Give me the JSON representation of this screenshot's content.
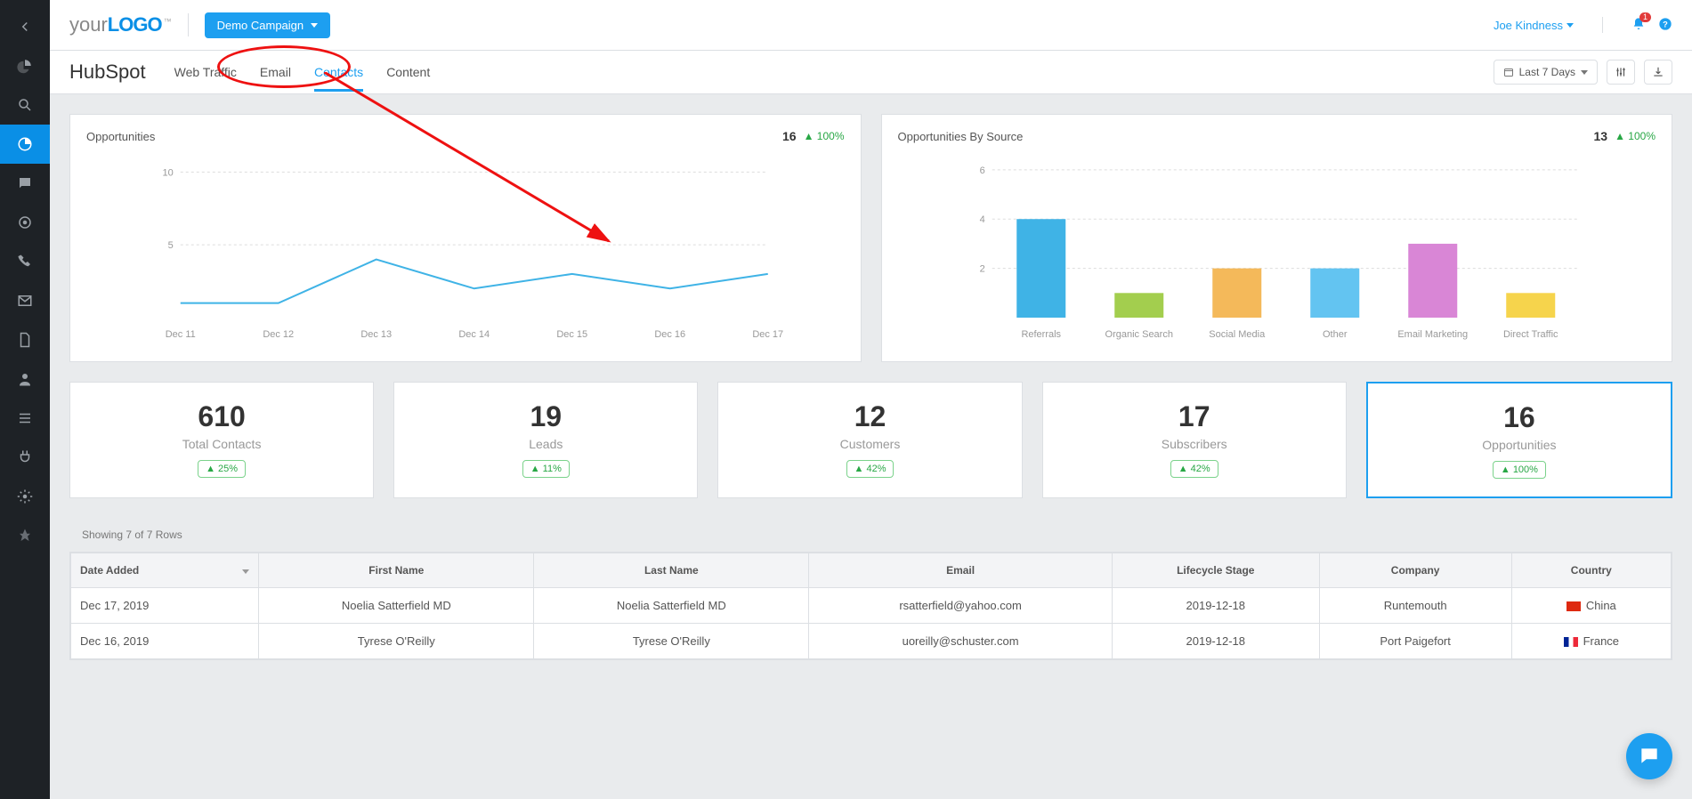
{
  "header": {
    "logo_prefix": "your",
    "logo_bold": "LOGO",
    "campaign_label": "Demo Campaign",
    "user_name": "Joe Kindness",
    "notification_count": "1"
  },
  "subnav": {
    "brand": "HubSpot",
    "tabs": [
      {
        "label": "Web Traffic",
        "active": false
      },
      {
        "label": "Email",
        "active": false
      },
      {
        "label": "Contacts",
        "active": true
      },
      {
        "label": "Content",
        "active": false
      }
    ],
    "date_range": "Last 7 Days"
  },
  "chart_data": [
    {
      "id": "opportunities",
      "type": "line",
      "title": "Opportunities",
      "metric_value": "16",
      "metric_delta": "100%",
      "categories": [
        "Dec 11",
        "Dec 12",
        "Dec 13",
        "Dec 14",
        "Dec 15",
        "Dec 16",
        "Dec 17"
      ],
      "values": [
        1,
        1,
        4,
        2,
        3,
        2,
        3
      ],
      "y_ticks": [
        5,
        10
      ],
      "ylim": [
        0,
        11
      ]
    },
    {
      "id": "opps_by_source",
      "type": "bar",
      "title": "Opportunities By Source",
      "metric_value": "13",
      "metric_delta": "100%",
      "categories": [
        "Referrals",
        "Organic Search",
        "Social Media",
        "Other",
        "Email Marketing",
        "Direct Traffic"
      ],
      "values": [
        4,
        1,
        2,
        2,
        3,
        1
      ],
      "colors": [
        "#3fb3e6",
        "#a3ce4e",
        "#f4b95a",
        "#63c4f1",
        "#d986d6",
        "#f6d44c"
      ],
      "y_ticks": [
        2,
        4,
        6
      ],
      "ylim": [
        0,
        6.5
      ]
    }
  ],
  "kpis": [
    {
      "value": "610",
      "label": "Total Contacts",
      "delta": "25%",
      "selected": false
    },
    {
      "value": "19",
      "label": "Leads",
      "delta": "11%",
      "selected": false
    },
    {
      "value": "12",
      "label": "Customers",
      "delta": "42%",
      "selected": false
    },
    {
      "value": "17",
      "label": "Subscribers",
      "delta": "42%",
      "selected": false
    },
    {
      "value": "16",
      "label": "Opportunities",
      "delta": "100%",
      "selected": true
    }
  ],
  "table": {
    "caption": "Showing 7 of 7 Rows",
    "columns": [
      "Date Added",
      "First Name",
      "Last Name",
      "Email",
      "Lifecycle Stage",
      "Company",
      "Country"
    ],
    "rows": [
      {
        "date": "Dec 17, 2019",
        "first": "Noelia Satterfield MD",
        "last": "Noelia Satterfield MD",
        "email": "rsatterfield@yahoo.com",
        "stage": "2019-12-18",
        "company": "Runtemouth",
        "country": "China",
        "flag": "cn"
      },
      {
        "date": "Dec 16, 2019",
        "first": "Tyrese O'Reilly",
        "last": "Tyrese O'Reilly",
        "email": "uoreilly@schuster.com",
        "stage": "2019-12-18",
        "company": "Port Paigefort",
        "country": "France",
        "flag": "fr"
      }
    ]
  },
  "rail_icons": [
    "chevron-left",
    "dashboard",
    "search",
    "pie",
    "chat",
    "target",
    "phone",
    "mail",
    "file",
    "user",
    "list",
    "plug",
    "gear",
    "pin"
  ]
}
